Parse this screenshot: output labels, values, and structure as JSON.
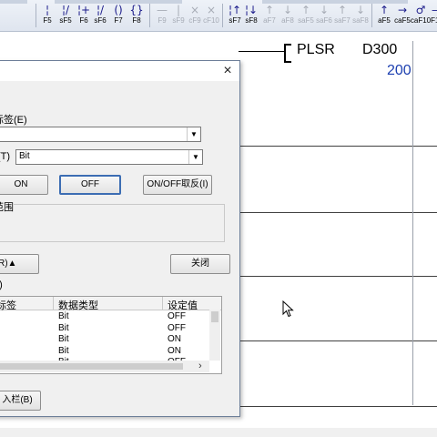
{
  "toolbar": {
    "buttons": [
      {
        "glyph": "¦",
        "key": "F5",
        "icon": "contact-no-icon",
        "enabled": true
      },
      {
        "glyph": "¦/",
        "key": "sF5",
        "icon": "contact-nc-icon",
        "enabled": true
      },
      {
        "glyph": "¦+",
        "key": "F6",
        "icon": "parallel-no-icon",
        "enabled": true
      },
      {
        "glyph": "¦/",
        "key": "sF6",
        "icon": "parallel-nc-icon",
        "enabled": true
      },
      {
        "glyph": "()",
        "key": "F7",
        "icon": "coil-icon",
        "enabled": true
      },
      {
        "glyph": "{}",
        "key": "F8",
        "icon": "instruction-icon",
        "enabled": true
      },
      {
        "glyph": "—",
        "key": "F9",
        "icon": "horizontal-line-icon",
        "enabled": false
      },
      {
        "glyph": "|",
        "key": "sF9",
        "icon": "vertical-line-icon",
        "enabled": false
      },
      {
        "glyph": "×",
        "key": "cF9",
        "icon": "delete-horizontal-icon",
        "enabled": false
      },
      {
        "glyph": "×",
        "key": "cF10",
        "icon": "delete-vertical-icon",
        "enabled": false
      },
      {
        "glyph": "¦↑",
        "key": "sF7",
        "icon": "rising-edge-icon",
        "enabled": true
      },
      {
        "glyph": "¦↓",
        "key": "sF8",
        "icon": "falling-edge-icon",
        "enabled": true
      },
      {
        "glyph": "↑",
        "key": "aF7",
        "icon": "parallel-rising-icon",
        "enabled": false
      },
      {
        "glyph": "↓",
        "key": "aF8",
        "icon": "parallel-falling-icon",
        "enabled": false
      },
      {
        "glyph": "↑",
        "key": "saF5",
        "icon": "op-rising-icon",
        "enabled": false
      },
      {
        "glyph": "↓",
        "key": "saF6",
        "icon": "op-falling-icon",
        "enabled": false
      },
      {
        "glyph": "↑",
        "key": "saF7",
        "icon": "op-rising-parallel-icon",
        "enabled": false
      },
      {
        "glyph": "↓",
        "key": "saF8",
        "icon": "op-falling-parallel-icon",
        "enabled": false
      },
      {
        "glyph": "↑",
        "key": "aF5",
        "icon": "invert-icon",
        "enabled": true
      },
      {
        "glyph": "→",
        "key": "caF5",
        "icon": "convert-icon",
        "enabled": true
      },
      {
        "glyph": "♂",
        "key": "caF10",
        "icon": "comment-icon",
        "enabled": true
      },
      {
        "glyph": "—",
        "key": "F10",
        "icon": "line-draw-icon",
        "enabled": true
      }
    ]
  },
  "ladder": {
    "instruction": "PLSR",
    "operand": "D300",
    "value": "200"
  },
  "dialog": {
    "device_label_suffix": "标签(E)",
    "type_label_suffix": "(T)",
    "data_type": "Bit",
    "buttons": {
      "on": "ON",
      "off": "OFF",
      "toggle": "ON/OFF取反(I)",
      "detail": "R)▲",
      "close": "关闭",
      "register": "入栏(B)"
    },
    "group_title": "范围",
    "list_label": "L)",
    "grid": {
      "headers": [
        "标签",
        "数据类型",
        "设定值"
      ],
      "rows": [
        {
          "type": "Bit",
          "value": "OFF"
        },
        {
          "type": "Bit",
          "value": "OFF"
        },
        {
          "type": "Bit",
          "value": "ON"
        },
        {
          "type": "Bit",
          "value": "ON"
        },
        {
          "type": "Bit",
          "value": "OFF"
        }
      ],
      "scroll_right": "›"
    },
    "close_icon": "×"
  }
}
